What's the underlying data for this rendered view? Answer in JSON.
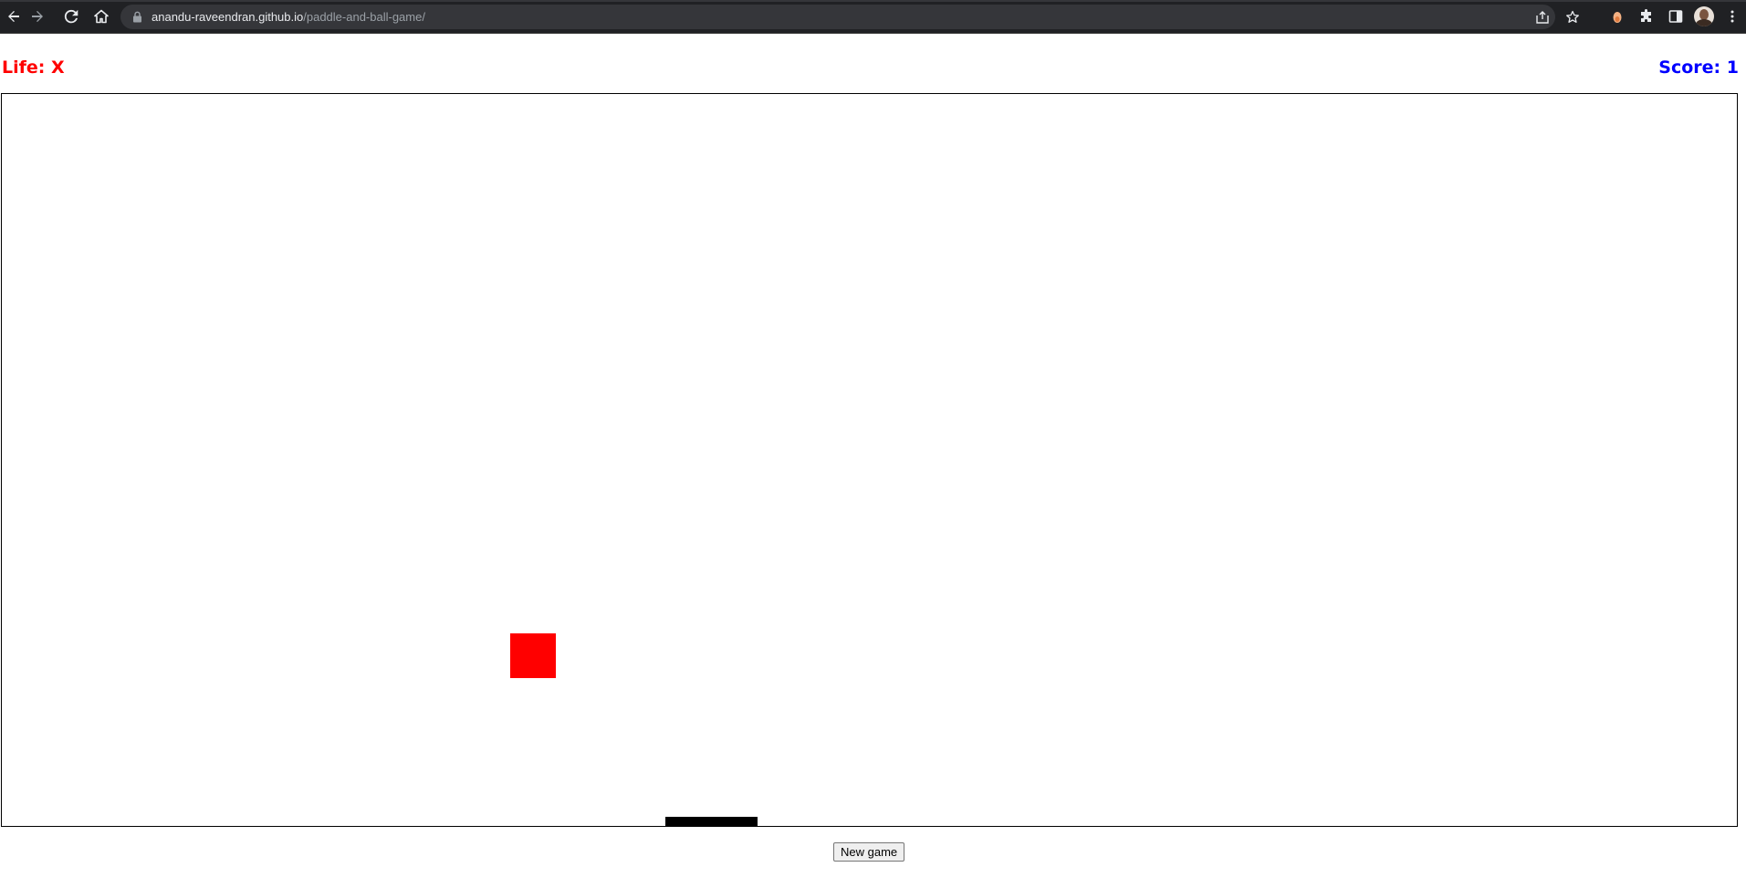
{
  "browser": {
    "url_host": "anandu-raveendran.github.io",
    "url_path": "/paddle-and-ball-game/",
    "icons": {
      "back": "back-arrow-icon",
      "forward": "forward-arrow-icon",
      "reload": "reload-icon",
      "home": "home-icon",
      "lock": "lock-icon",
      "share": "share-icon",
      "bookmark": "star-icon",
      "extension": "extension-icon",
      "puzzle": "puzzle-icon",
      "sidepanel": "side-panel-icon",
      "menu": "kebab-menu-icon"
    },
    "chrome_color": "#202124"
  },
  "game": {
    "life_label": "Life: X",
    "score_label": "Score: 1",
    "life_color": "#ff0000",
    "score_color": "#0000ff",
    "ball_color": "#ff0000",
    "paddle_color": "#000000",
    "new_game_label": "New game"
  }
}
